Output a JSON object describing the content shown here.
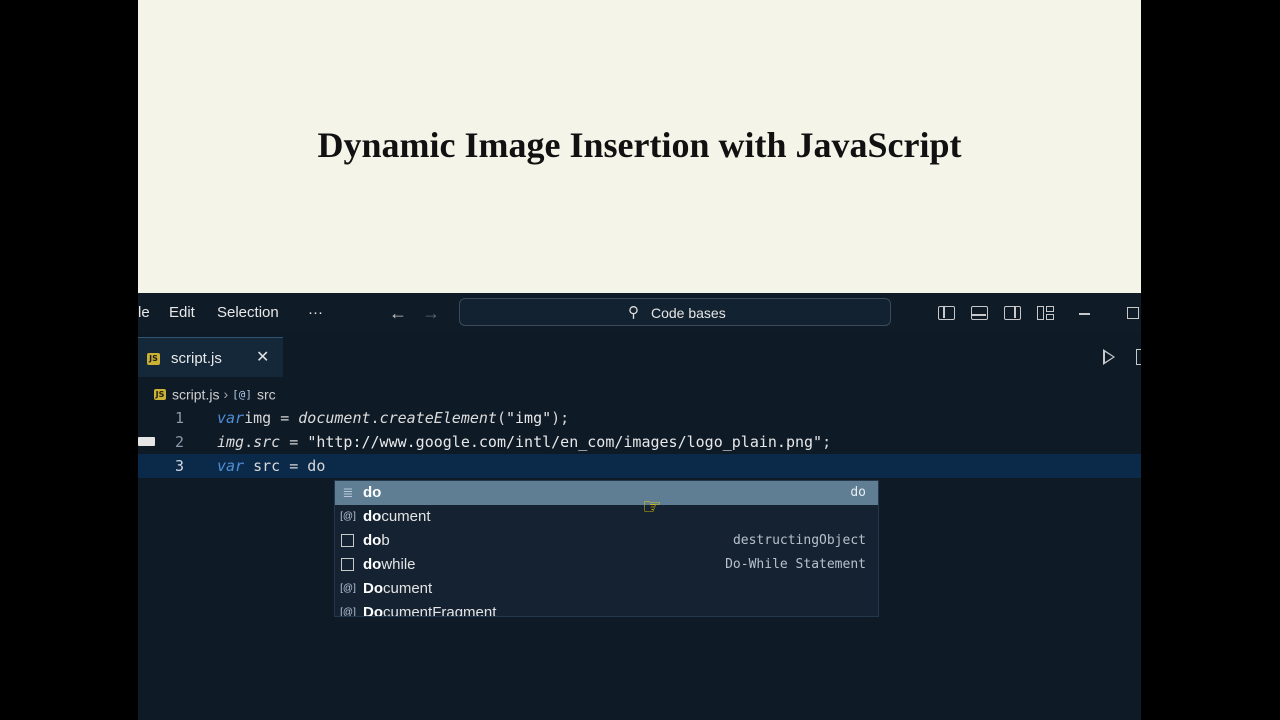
{
  "preview": {
    "heading": "Dynamic Image Insertion with JavaScript"
  },
  "titlebar": {
    "menu": [
      "le",
      "Edit",
      "Selection",
      "···"
    ],
    "search": "Code bases"
  },
  "tab": {
    "badge": "JS",
    "label": "script.js"
  },
  "breadcrumb": {
    "file": "script.js",
    "symbol": "src"
  },
  "code": {
    "lines": [
      {
        "n": "1",
        "parts": [
          [
            "kw",
            "var"
          ],
          [
            "",
            "img = "
          ],
          [
            "it",
            "document"
          ],
          [
            "",
            "."
          ],
          [
            "it",
            "createElement"
          ],
          [
            "",
            "("
          ],
          [
            "str",
            "\"img\""
          ],
          [
            "",
            ");"
          ]
        ]
      },
      {
        "n": "2",
        "parts": [
          [
            "it",
            "img"
          ],
          [
            "",
            "."
          ],
          [
            "it",
            "src"
          ],
          [
            "",
            " = "
          ],
          [
            "str",
            "\"http://www.google.com/intl/en_com/images/logo_plain.png\""
          ],
          [
            "",
            ";"
          ]
        ]
      },
      {
        "n": "3",
        "parts": [
          [
            "kw",
            "var"
          ],
          [
            "",
            " src = do"
          ]
        ]
      }
    ]
  },
  "suggest": {
    "items": [
      {
        "icon": "keyword",
        "match": "do",
        "rest": "",
        "detail": "do"
      },
      {
        "icon": "variable",
        "match": "do",
        "rest": "cument",
        "detail": ""
      },
      {
        "icon": "snippet",
        "match": "do",
        "rest": "b",
        "detail": "destructingObject"
      },
      {
        "icon": "snippet",
        "match": "do",
        "rest": "while",
        "detail": "Do-While Statement"
      },
      {
        "icon": "variable",
        "match": "Do",
        "rest": "cument",
        "detail": ""
      },
      {
        "icon": "variable",
        "match": "Do",
        "rest": "cumentFragment",
        "detail": ""
      }
    ]
  },
  "colors": {
    "editor_bg": "#0e1a26",
    "selection": "#5f7e94",
    "keyword": "#4e8fd6"
  }
}
